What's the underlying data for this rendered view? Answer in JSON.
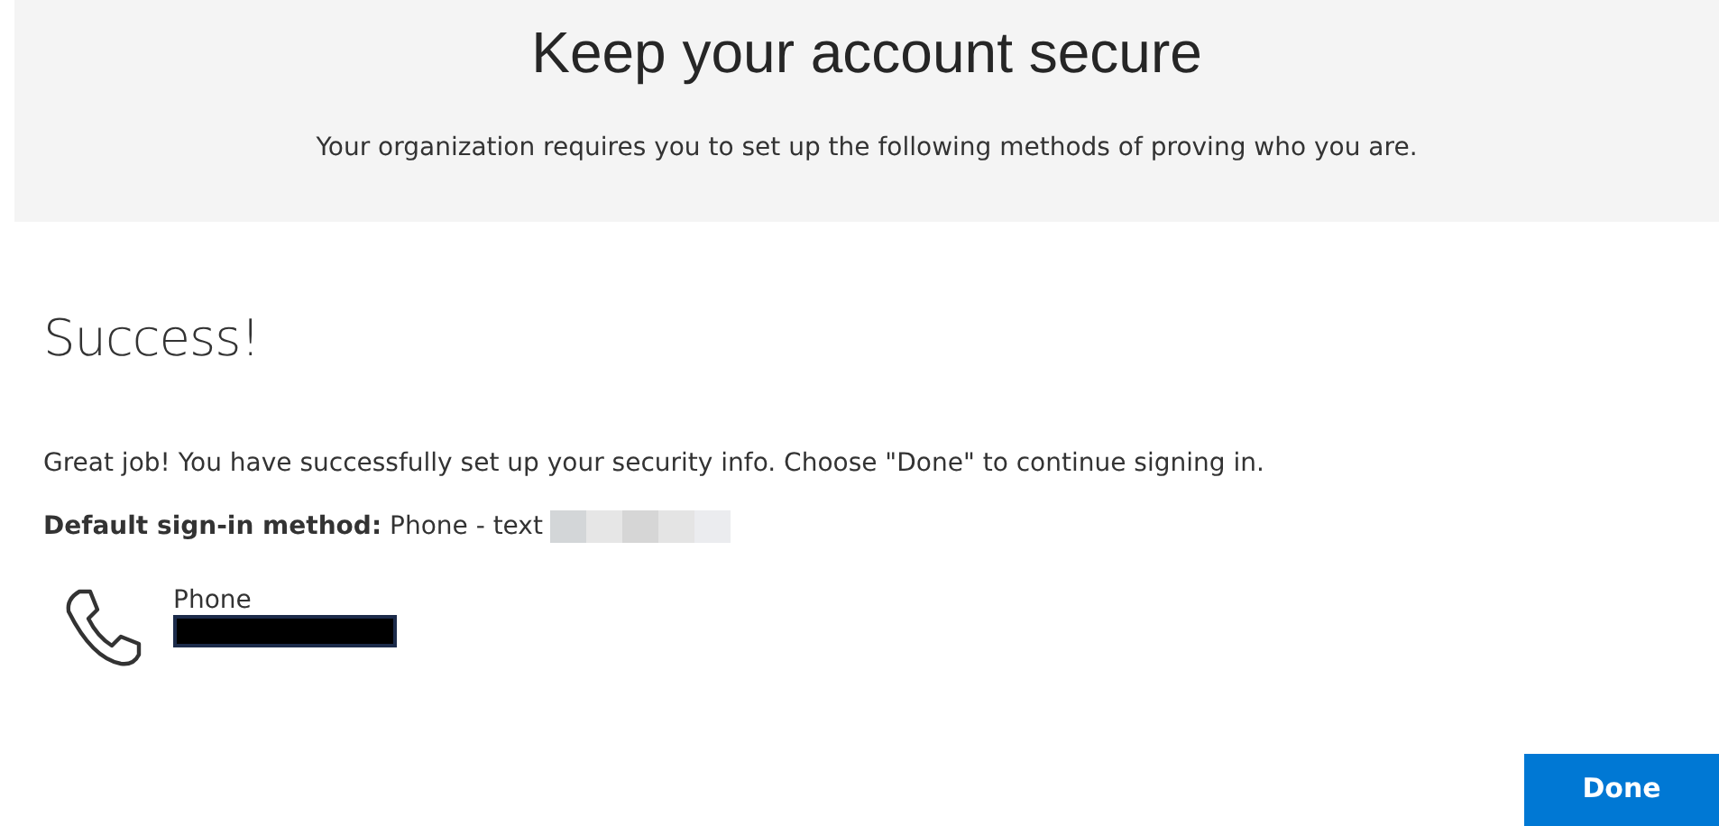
{
  "header": {
    "title": "Keep your account secure",
    "subtitle": "Your organization requires you to set up the following methods of proving who you are."
  },
  "heading": "Success!",
  "message": "Great job! You have successfully set up your security info. Choose \"Done\" to continue signing in.",
  "default_method": "**Default sign-in method:** Phone - text",
  "method": {
    "label": "Phone"
  },
  "buttons": [
    {
      "label": "Done"
    }
  ]
}
